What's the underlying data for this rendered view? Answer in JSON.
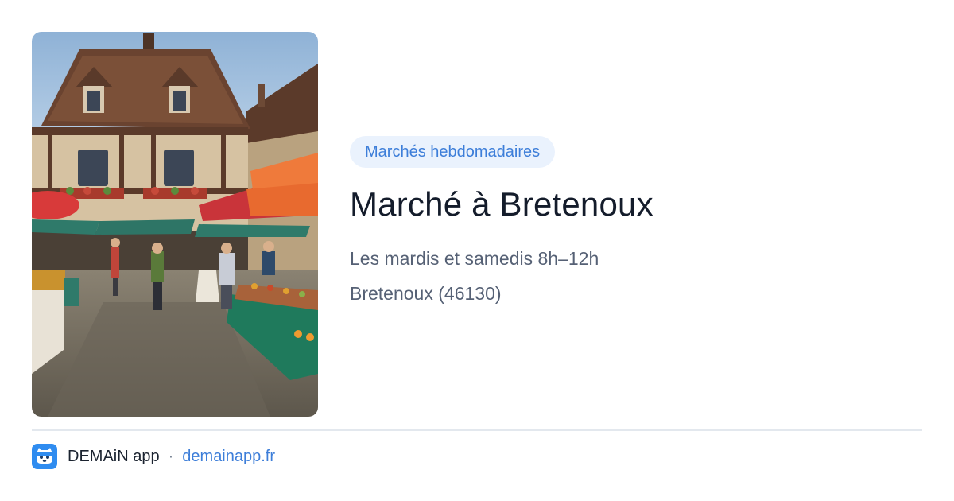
{
  "card": {
    "image_alt": "Market stalls with parasols in the square in front of a half-timbered house",
    "category": "Marchés hebdomadaires",
    "title": "Marché à Bretenoux",
    "schedule": "Les mardis et samedis 8h–12h",
    "location": "Bretenoux (46130)"
  },
  "footer": {
    "app_name": "DEMAiN app",
    "separator": "·",
    "url": "demainapp.fr",
    "logo_icon": "app-logo-icon"
  },
  "colors": {
    "accent": "#3d7ed9",
    "badge_background": "#eaf2fd",
    "logo_background": "#2f8cf0"
  }
}
